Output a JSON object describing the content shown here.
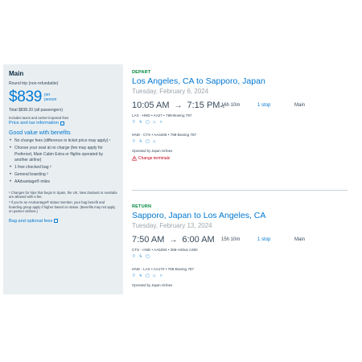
{
  "summary": {
    "cabin": "Main",
    "trip_type": "Round trip (non-refundable)",
    "price": "$839",
    "per_person": "per person",
    "total": "Total $838.20 (all passengers)",
    "includes": "Includes taxes and carrier-imposed fees",
    "price_tax_link": "Price and tax information",
    "benefits_title": "Good value with benefits",
    "benefits": [
      "No change fees (difference in ticket price may apply) ¹",
      "Choose your seat at no charge (fee may apply for Preferred, Main Cabin Extra or flights operated by another airline)",
      "1 free checked bag ²",
      "General boarding ²",
      "AAdvantage® miles"
    ],
    "footnote1": "¹ Changes for trips that begin in Spain, the UK, New Zealand or Australia are allowed with a fee.",
    "footnote2": "² If you're an AAdvantage® status member, your bag benefit and boarding group apply if higher based on status. (Benefits may not apply on partner airlines.)",
    "bag_link": "Bag and optional fees"
  },
  "depart": {
    "label": "DEPART",
    "route": "Los Angeles, CA to Sapporo, Japan",
    "date": "Tuesday, February 6, 2024",
    "dep_time": "10:05 AM",
    "arr_time": "7:15 PM",
    "day_offset": "+1",
    "duration": "16h 10m",
    "stops": "1 stop",
    "cabin": "Main",
    "leg1": "LAX - HND  •  AA27  •  788-Boeing 787",
    "leg2": "HND - CTS  •  AA4406  •  788-Boeing 787",
    "operated": "Operated by Japan Airlines",
    "change_terminals": "Change terminals"
  },
  "return": {
    "label": "RETURN",
    "route": "Sapporo, Japan to Los Angeles, CA",
    "date": "Tuesday, February 13, 2024",
    "dep_time": "7:50 AM",
    "arr_time": "6:00 AM",
    "duration": "15h 10m",
    "stops": "1 stop",
    "cabin": "Main",
    "leg1": "CTS - HND  •  AA5393  •  359-Airbus A350",
    "leg2": "HND - LAX  •  AA170  •  788-Boeing 787",
    "operated": "Operated by Japan Airlines"
  },
  "colors": {
    "accent": "#0078d2",
    "depart_label": "#00873c",
    "warning": "#c30019",
    "panel_bg": "#e9eef1"
  },
  "amenity_icons": [
    "wifi-icon",
    "power-icon",
    "entertainment-icon",
    "food-icon",
    "drink-icon"
  ]
}
